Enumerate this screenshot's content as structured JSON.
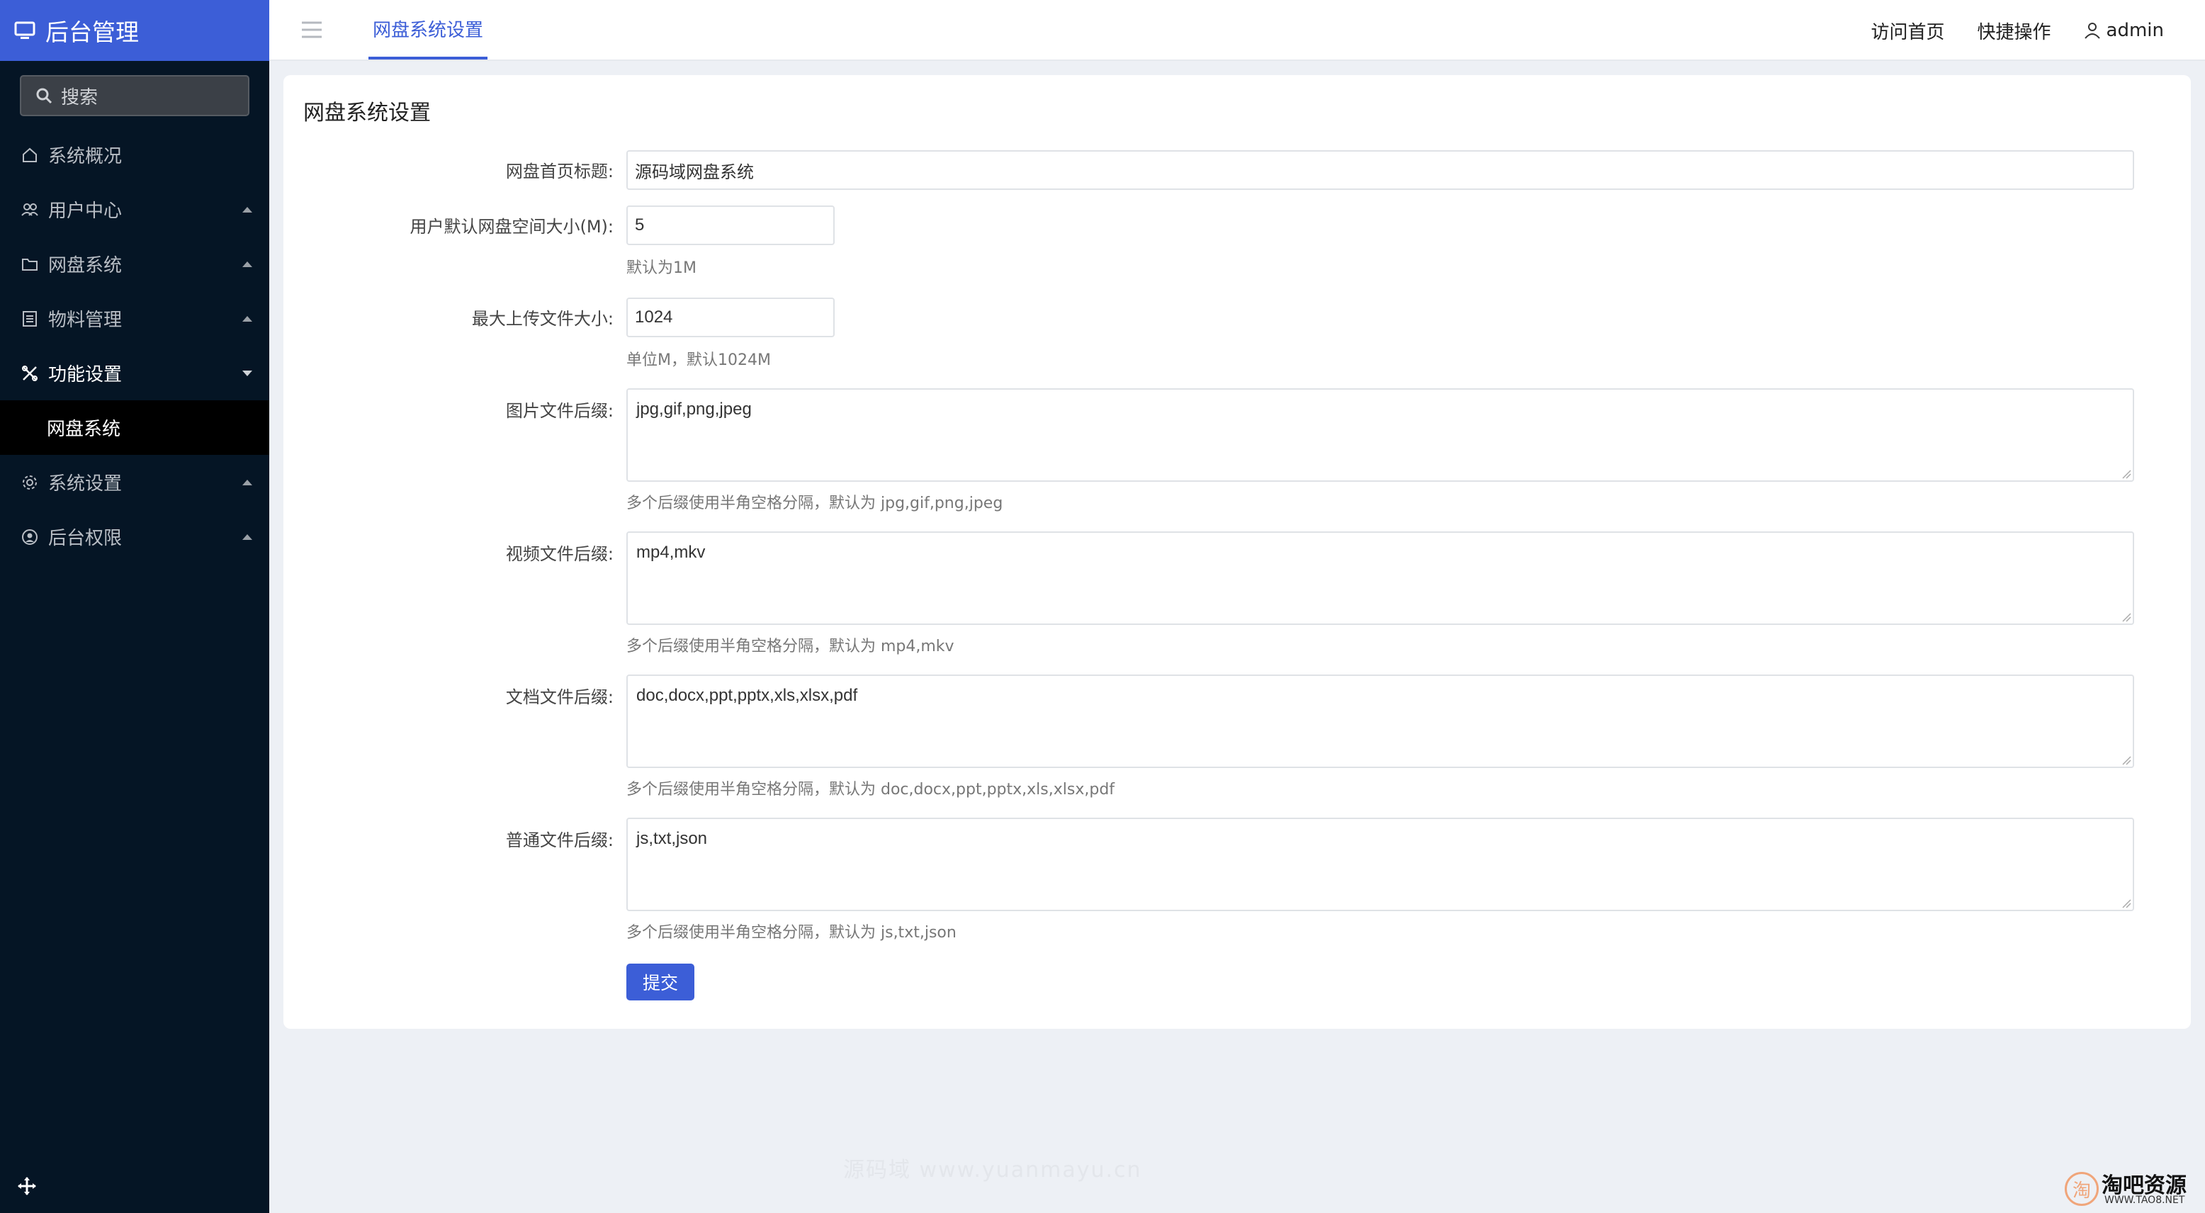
{
  "sidebar": {
    "brand": "后台管理",
    "search_placeholder": "搜索",
    "items": [
      {
        "label": "系统概况",
        "icon": "home-icon"
      },
      {
        "label": "用户中心",
        "icon": "users-icon"
      },
      {
        "label": "网盘系统",
        "icon": "folder-icon"
      },
      {
        "label": "物料管理",
        "icon": "list-icon"
      },
      {
        "label": "功能设置",
        "icon": "tools-icon"
      },
      {
        "label": "系统设置",
        "icon": "gear-icon"
      },
      {
        "label": "后台权限",
        "icon": "user-circle-icon"
      }
    ],
    "submenu_active": "网盘系统"
  },
  "topbar": {
    "tab": "网盘系统设置",
    "links": [
      "访问首页",
      "快捷操作"
    ],
    "user": "admin"
  },
  "form": {
    "title": "网盘系统设置",
    "site_title": {
      "label": "网盘首页标题:",
      "value": "源码域网盘系统"
    },
    "default_space": {
      "label": "用户默认网盘空间大小(M):",
      "value": "5",
      "hint": "默认为1M"
    },
    "max_upload": {
      "label": "最大上传文件大小:",
      "value": "1024",
      "hint": "单位M，默认1024M"
    },
    "image_ext": {
      "label": "图片文件后缀:",
      "value": "jpg,gif,png,jpeg",
      "hint": "多个后缀使用半角空格分隔，默认为 jpg,gif,png,jpeg"
    },
    "video_ext": {
      "label": "视频文件后缀:",
      "value": "mp4,mkv",
      "hint": "多个后缀使用半角空格分隔，默认为 mp4,mkv"
    },
    "doc_ext": {
      "label": "文档文件后缀:",
      "value": "doc,docx,ppt,pptx,xls,xlsx,pdf",
      "hint": "多个后缀使用半角空格分隔，默认为 doc,docx,ppt,pptx,xls,xlsx,pdf"
    },
    "common_ext": {
      "label": "普通文件后缀:",
      "value": "js,txt,json",
      "hint": "多个后缀使用半角空格分隔，默认为 js,txt,json"
    },
    "submit_label": "提交"
  },
  "watermark": "源码域 www.yuanmayu.cn",
  "corner_logo": {
    "seal": "淘",
    "name": "淘吧资源",
    "url": "WWW.TAO8.NET"
  },
  "colors": {
    "accent": "#3c5ed7",
    "sidebar_bg": "#051525"
  }
}
